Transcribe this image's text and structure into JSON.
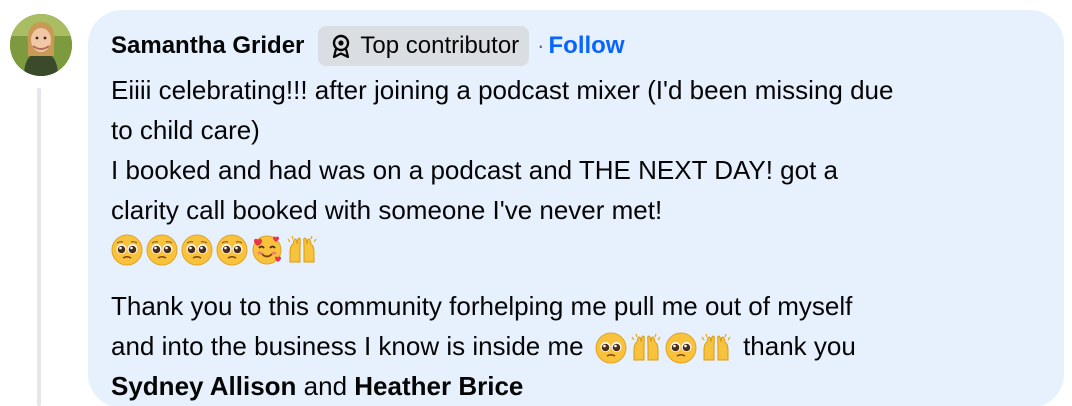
{
  "comment": {
    "author": "Samantha Grider",
    "badge_label": "Top contributor",
    "separator": "·",
    "follow_label": "Follow",
    "paragraph1": [
      "Eiiii celebrating!!! after joining a podcast mixer (I'd been missing due",
      "to child care)",
      "I booked and had was on a podcast and THE NEXT DAY! got a",
      "clarity call booked with someone I've never met!"
    ],
    "paragraph2_line1": "Thank you to this community forhelping me pull me out of myself",
    "paragraph2_line2_start": "and into the business I know is inside me",
    "paragraph2_line2_end": "thank you",
    "mention1": "Sydney Allison",
    "conjunction": "and",
    "mention2": "Heather Brice"
  },
  "icons": {
    "badge": "award-ribbon-icon",
    "emoji_row": [
      "pleading-face-emoji",
      "pleading-face-emoji",
      "pleading-face-emoji",
      "pleading-face-emoji",
      "smiling-face-with-hearts-emoji",
      "raising-hands-emoji"
    ],
    "emoji_inline": [
      "pleading-face-emoji",
      "raising-hands-emoji",
      "pleading-face-emoji",
      "raising-hands-emoji"
    ]
  },
  "colors": {
    "bubble_bg": "#e7f1fd",
    "badge_bg": "#dadde1",
    "follow": "#0866ff",
    "text": "#050505"
  }
}
